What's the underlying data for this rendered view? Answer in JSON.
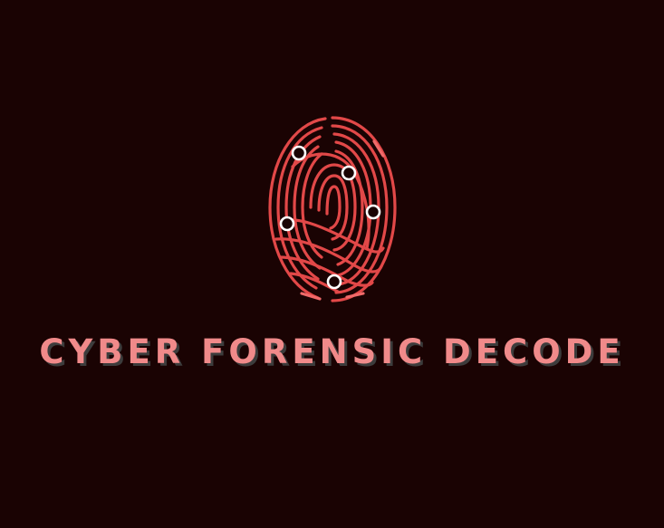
{
  "logo": {
    "wordmark": "CYBER FORENSIC DECODE",
    "icon": "fingerprint-icon",
    "ridge_color": "#e24848",
    "ridge_color_light": "#f06a6a",
    "marker_color": "#ffffff",
    "text_color": "#f08a8a",
    "shadow_color": "#3c3c3c",
    "background": "#1a0303"
  }
}
